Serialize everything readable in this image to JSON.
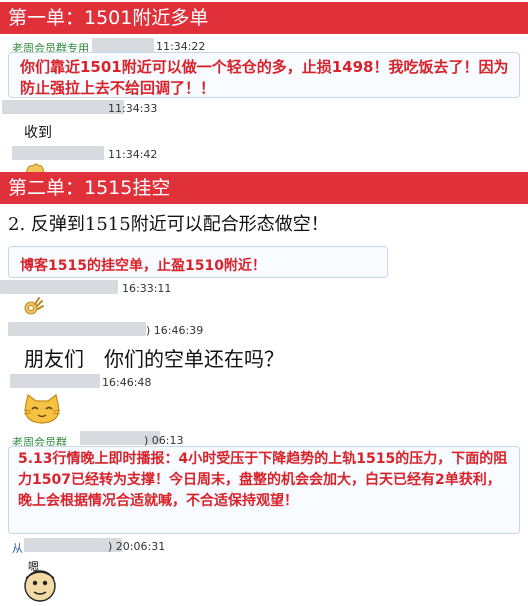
{
  "order1": {
    "banner": "第一单：1501附近多单",
    "sender": "老周会员群专用",
    "msg1_time": "11:34:22",
    "msg1_text": "你们靠近1501附近可以做一个轻仓的多，止损1498！我吃饭去了！因为防止强拉上去不给回调了！！",
    "reply1_time": "11:34:33",
    "reply1_text": "收到",
    "reply2_time": "11:34:42"
  },
  "order2": {
    "banner": "第二单：1515挂空",
    "subheading": "2. 反弹到1515附近可以配合形态做空！",
    "msg1_text": "博客1515的挂空单，止盈1510附近！",
    "msg1_time": "16:33:11",
    "msg2_time": ") 16:46:39",
    "msg2_text": "朋友们　你们的空单还在吗？",
    "msg3_time": "16:46:48",
    "sender2": "老周会员群",
    "msg4_time": ") 06:13",
    "msg4_text": "5.13行情晚上即时播报：4小时受压于下降趋势的上轨1515的压力，下面的阻力1507已经转为支撑！今日周末，盘整的机会会加大，白天已经有2单获利，晚上会根据情况合适就喊，不合适保持观望！",
    "from_prefix": "从",
    "msg5_time": ") 20:06:31",
    "sticker_text": "嗯"
  },
  "icons": [
    "waving-hand-icon",
    "ok-hand-icon",
    "cat-face-sticker",
    "cartoon-man-sticker"
  ],
  "colors": {
    "banner": "#e0303a",
    "alert_text": "#d8232a",
    "sender_green": "#2a8a3a"
  }
}
